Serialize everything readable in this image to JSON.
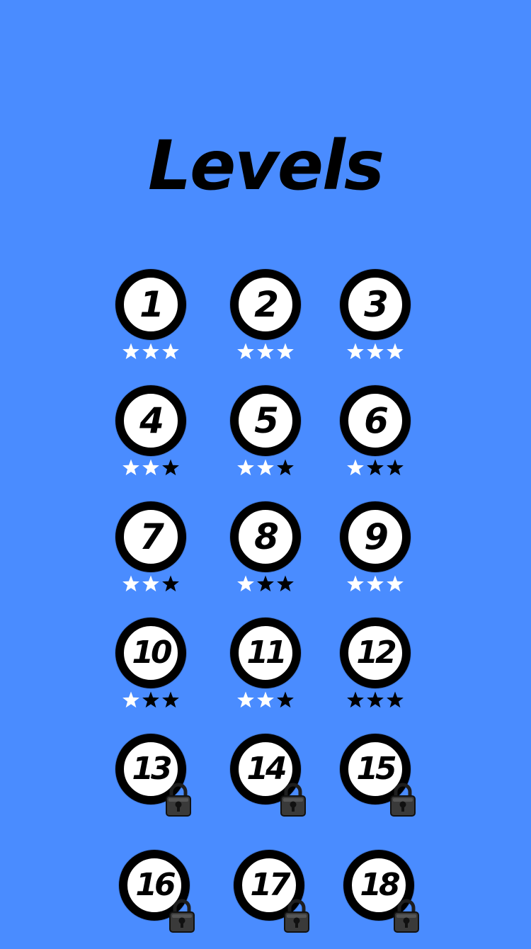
{
  "title": "Levels",
  "colors": {
    "background": "#4a8cff",
    "star_earned": "#ffffff",
    "star_missing": "#000000",
    "lock": "#3a3a3a"
  },
  "levels": [
    {
      "number": "1",
      "stars": 3,
      "locked": false
    },
    {
      "number": "2",
      "stars": 3,
      "locked": false
    },
    {
      "number": "3",
      "stars": 3,
      "locked": false
    },
    {
      "number": "4",
      "stars": 2,
      "locked": false
    },
    {
      "number": "5",
      "stars": 2,
      "locked": false
    },
    {
      "number": "6",
      "stars": 1,
      "locked": false
    },
    {
      "number": "7",
      "stars": 2,
      "locked": false
    },
    {
      "number": "8",
      "stars": 1,
      "locked": false
    },
    {
      "number": "9",
      "stars": 3,
      "locked": false
    },
    {
      "number": "10",
      "stars": 1,
      "locked": false
    },
    {
      "number": "11",
      "stars": 2,
      "locked": false
    },
    {
      "number": "12",
      "stars": 0,
      "locked": false
    },
    {
      "number": "13",
      "stars": 0,
      "locked": true
    },
    {
      "number": "14",
      "stars": 0,
      "locked": true
    },
    {
      "number": "15",
      "stars": 0,
      "locked": true
    },
    {
      "number": "16",
      "stars": 0,
      "locked": true
    },
    {
      "number": "17",
      "stars": 0,
      "locked": true
    },
    {
      "number": "18",
      "stars": 0,
      "locked": true
    }
  ],
  "icons": {
    "star": "star-icon",
    "lock": "padlock-icon"
  }
}
